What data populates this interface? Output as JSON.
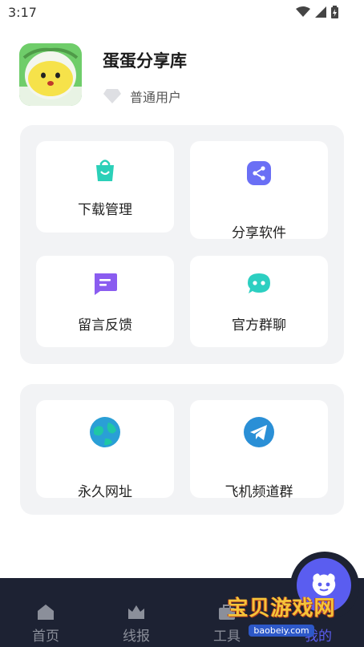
{
  "status_bar": {
    "time": "3:17"
  },
  "profile": {
    "name": "蛋蛋分享库",
    "level": "普通用户"
  },
  "features": [
    {
      "label": "下载管理"
    },
    {
      "label": "分享软件"
    },
    {
      "label": "留言反馈"
    },
    {
      "label": "官方群聊"
    }
  ],
  "links": [
    {
      "label": "永久网址"
    },
    {
      "label": "飞机频道群"
    }
  ],
  "bottom_nav": [
    {
      "label": "首页"
    },
    {
      "label": "线报"
    },
    {
      "label": "工具"
    },
    {
      "label": "我的"
    }
  ],
  "watermark": {
    "title": "宝贝游戏网",
    "url": "baobeiy.com"
  },
  "colors": {
    "panel_bg": "#f2f3f5",
    "nav_bg": "#1d2233",
    "accent": "#5a5df0",
    "download": "#2bd0b8",
    "share": "#6a6ff5",
    "feedback": "#8a5cf0",
    "group": "#2ccfc1",
    "globe": "#2a9fd6",
    "telegram": "#2a8fd6"
  }
}
